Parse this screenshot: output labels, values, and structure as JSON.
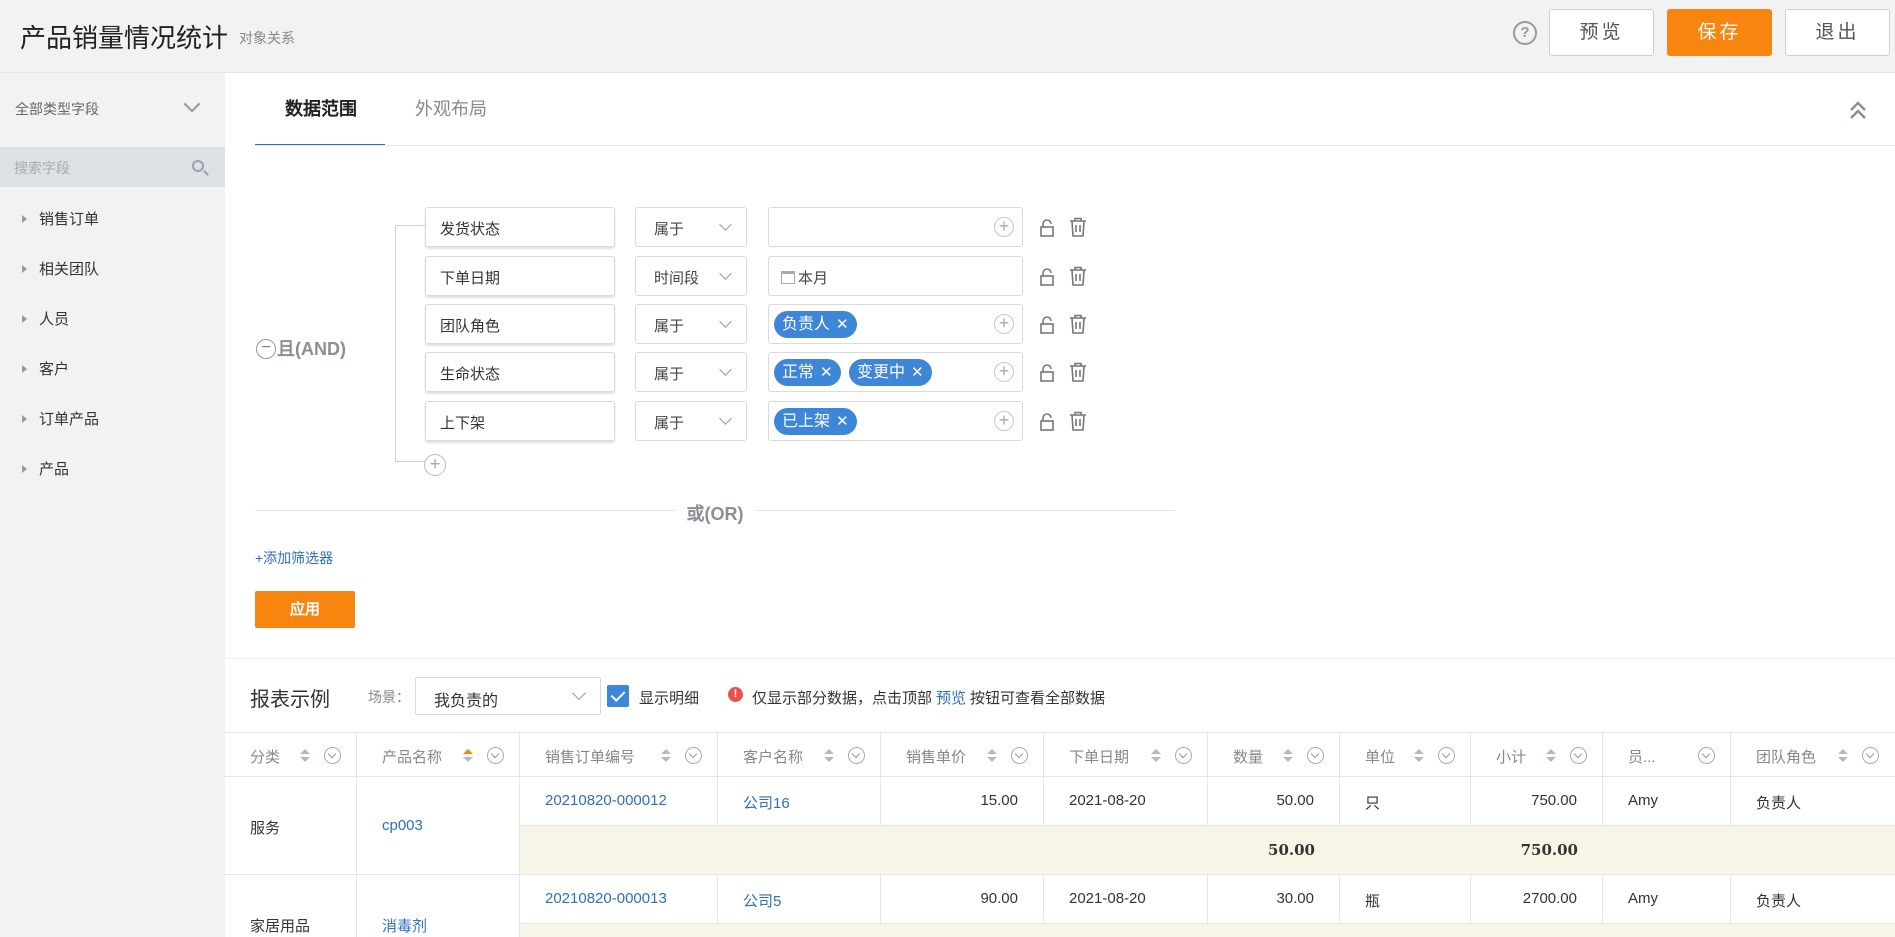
{
  "app": {
    "title": "产品销量情况统计",
    "subtitle": "对象关系",
    "help": "?"
  },
  "toolbar": {
    "preview_label": "预览",
    "save_label": "保存",
    "exit_label": "退出"
  },
  "sidebar": {
    "field_type": "全部类型字段",
    "search_placeholder": "搜索字段",
    "items": [
      "销售订单",
      "相关团队",
      "人员",
      "客户",
      "订单产品",
      "产品"
    ]
  },
  "tabs": [
    {
      "label": "数据范围",
      "active": true
    },
    {
      "label": "外观布局",
      "active": false
    }
  ],
  "filter": {
    "and_label": "且(AND)",
    "or_label": "或(OR)",
    "add_filter_label": "+添加筛选器",
    "apply_label": "应用",
    "conditions": [
      {
        "field": "发货状态",
        "operator": "属于",
        "values": []
      },
      {
        "field": "下单日期",
        "operator": "时间段",
        "date": "本月"
      },
      {
        "field": "团队角色",
        "operator": "属于",
        "values": [
          "负责人"
        ]
      },
      {
        "field": "生命状态",
        "operator": "属于",
        "values": [
          "正常",
          "变更中"
        ]
      },
      {
        "field": "上下架",
        "operator": "属于",
        "values": [
          "已上架"
        ]
      }
    ]
  },
  "report": {
    "title": "报表示例",
    "scene_label": "场景：",
    "scene_value": "我负责的",
    "show_detail_label": "显示明细",
    "show_detail_checked": true,
    "notice_before": "仅显示部分数据，点击顶部",
    "notice_link": "预览",
    "notice_after": "按钮可查看全部数据",
    "columns": [
      "分类",
      "产品名称",
      "销售订单编号",
      "客户名称",
      "销售单价",
      "下单日期",
      "数量",
      "单位",
      "小计",
      "员...",
      "团队角色"
    ],
    "groups": [
      {
        "category": "服务",
        "product": "cp003",
        "rows": [
          {
            "order_no": "20210820-000012",
            "customer": "公司16",
            "unit_price": "15.00",
            "date": "2021-08-20",
            "qty": "50.00",
            "unit": "只",
            "subtotal": "750.00",
            "employee": "Amy",
            "role": "负责人"
          }
        ],
        "sum_qty": "50.00",
        "sum_subtotal": "750.00"
      },
      {
        "category": "家居用品",
        "product": "消毒剂",
        "rows": [
          {
            "order_no": "20210820-000013",
            "customer": "公司5",
            "unit_price": "90.00",
            "date": "2021-08-20",
            "qty": "30.00",
            "unit": "瓶",
            "subtotal": "2700.00",
            "employee": "Amy",
            "role": "负责人"
          }
        ]
      }
    ]
  },
  "colors": {
    "accent": "#f7850f",
    "link": "#2f6fbf",
    "tag": "#3d86d8",
    "subtotal_bg": "#f7f5e6"
  }
}
